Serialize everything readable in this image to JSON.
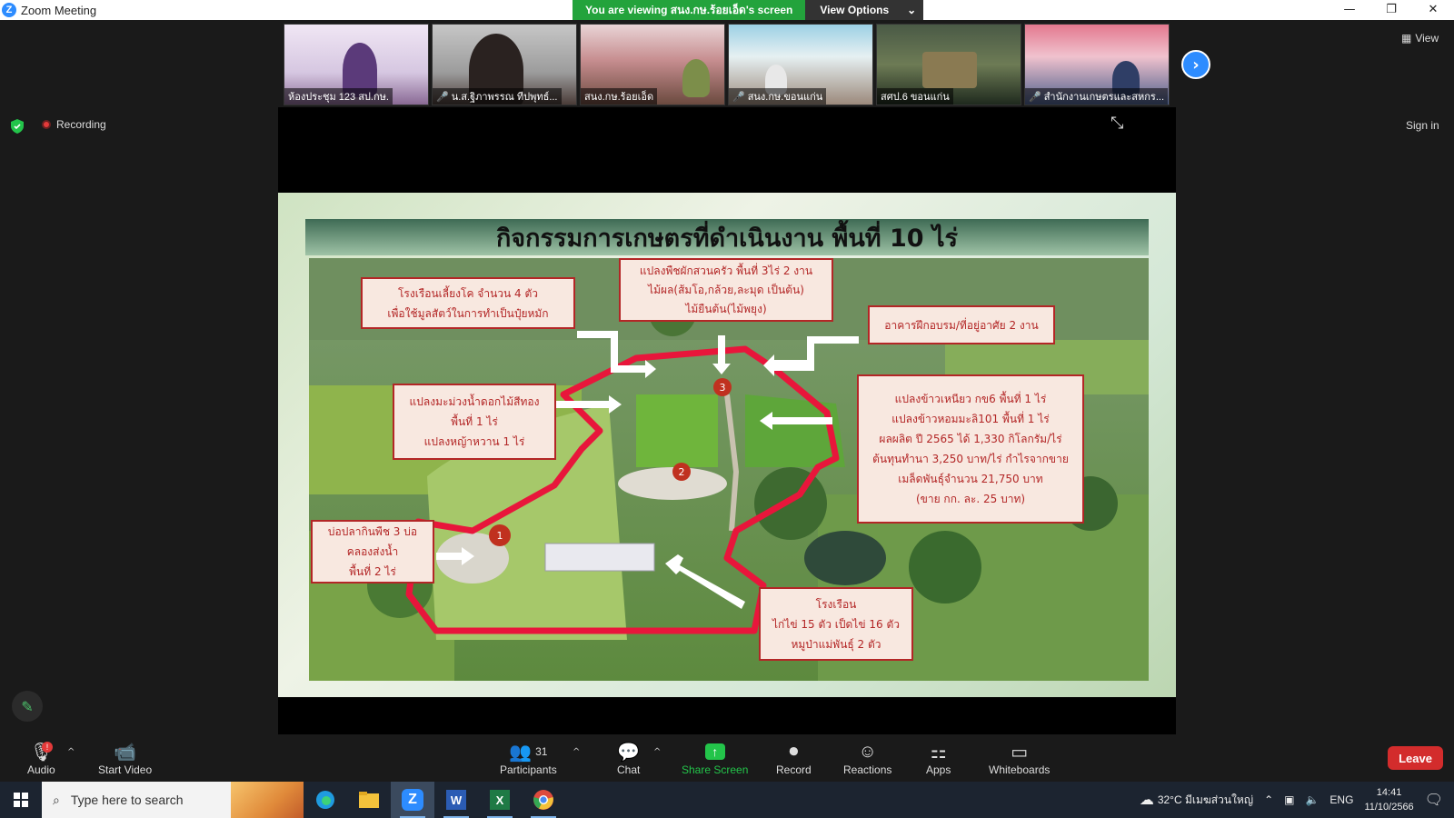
{
  "window": {
    "title": "Zoom Meeting",
    "controls": {
      "minimize": "—",
      "restore": "❐",
      "close": "✕"
    }
  },
  "share_banner": {
    "message": "You are viewing สนง.กษ.ร้อยเอ็ด's screen",
    "options_label": "View Options"
  },
  "participants_strip": [
    {
      "name": "ห้องประชุม 123 สป.กษ.",
      "muted": false
    },
    {
      "name": "น.ส.ฐิภาพรรณ ทีปพุทธ์...",
      "muted": true
    },
    {
      "name": "สนง.กษ.ร้อยเอ็ด",
      "muted": false
    },
    {
      "name": "สนง.กษ.ขอนแก่น",
      "muted": true
    },
    {
      "name": "สศป.6 ขอนแก่น",
      "muted": false
    },
    {
      "name": "สำนักงานเกษตรและสหกร...",
      "muted": true
    }
  ],
  "view_button": "View",
  "recording_label": "Recording",
  "signin_label": "Sign in",
  "slide": {
    "title": "กิจกรรมการเกษตรที่ดำเนินงาน พื้นที่ 10 ไร่",
    "markers": [
      "1",
      "2",
      "3"
    ],
    "labels": {
      "cattle_shed": [
        "โรงเรือนเลี้ยงโค จำนวน 4 ตัว",
        "เพื่อใช้มูลสัตว์ในการทำเป็นปุ๋ยหมัก"
      ],
      "garden": [
        "แปลงพืชผักสวนครัว พื้นที่ 3ไร่ 2 งาน",
        "ไม้ผล(ส้มโอ,กล้วย,ละมุด เป็นต้น)",
        "ไม้ยืนต้น(ไม้พยุง)"
      ],
      "training": [
        "อาคารฝึกอบรม/ที่อยู่อาศัย 2 งาน"
      ],
      "mango": [
        "แปลงมะม่วงน้ำดอกไม้สีทอง",
        "พื้นที่ 1 ไร่",
        "แปลงหญ้าหวาน 1 ไร่"
      ],
      "rice": [
        "แปลงข้าวเหนียว กข6 พื้นที่ 1 ไร่",
        "แปลงข้าวหอมมะลิ101 พื้นที่ 1 ไร่",
        "ผลผลิต ปี 2565 ได้ 1,330 กิโลกรัม/ไร่",
        "ต้นทุนทำนา 3,250 บาท/ไร่ กำไรจากขาย",
        "เมล็ดพันธุ์จำนวน 21,750 บาท",
        "(ขาย กก. ละ. 25 บาท)"
      ],
      "pond": [
        "บ่อปลากินพืช 3 บ่อ",
        "คลองส่งน้ำ",
        "พื้นที่ 2 ไร่"
      ],
      "henhouse": [
        "โรงเรือน",
        "ไก่ไข่ 15 ตัว เป็ดไข่ 16 ตัว",
        "หมูป่าแม่พันธุ์ 2 ตัว"
      ]
    }
  },
  "toolbar": {
    "audio": "Audio",
    "start_video": "Start Video",
    "participants": "Participants",
    "participants_count": "31",
    "chat": "Chat",
    "share_screen": "Share Screen",
    "record": "Record",
    "reactions": "Reactions",
    "apps": "Apps",
    "whiteboards": "Whiteboards",
    "leave": "Leave",
    "audio_badge": "!"
  },
  "taskbar": {
    "search_placeholder": "Type here to search",
    "weather": "32°C มีเมฆส่วนใหญ่",
    "language": "ENG",
    "time": "14:41",
    "date": "11/10/2566"
  },
  "colors": {
    "zoom_blue": "#2d8cff",
    "share_green": "#23a33c",
    "leave_red": "#d32c2c",
    "label_red": "#b32626"
  }
}
